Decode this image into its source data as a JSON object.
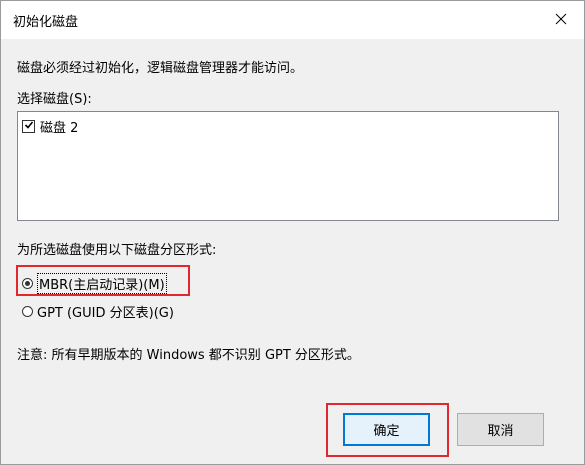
{
  "window": {
    "title": "初始化磁盘"
  },
  "dialog": {
    "description": "磁盘必须经过初始化，逻辑磁盘管理器才能访问。",
    "select_disk_label": "选择磁盘(S):",
    "disks": [
      {
        "label": "磁盘 2",
        "checked": true
      }
    ],
    "partition_style_label": "为所选磁盘使用以下磁盘分区形式:",
    "partition_options": [
      {
        "label": "MBR(主启动记录)(M)",
        "selected": true
      },
      {
        "label": "GPT (GUID 分区表)(G)",
        "selected": false
      }
    ],
    "note": "注意: 所有早期版本的 Windows 都不识别 GPT 分区形式。",
    "ok_label": "确定",
    "cancel_label": "取消"
  },
  "colors": {
    "highlight": "#e0282e",
    "default_button_border": "#0078d7"
  }
}
